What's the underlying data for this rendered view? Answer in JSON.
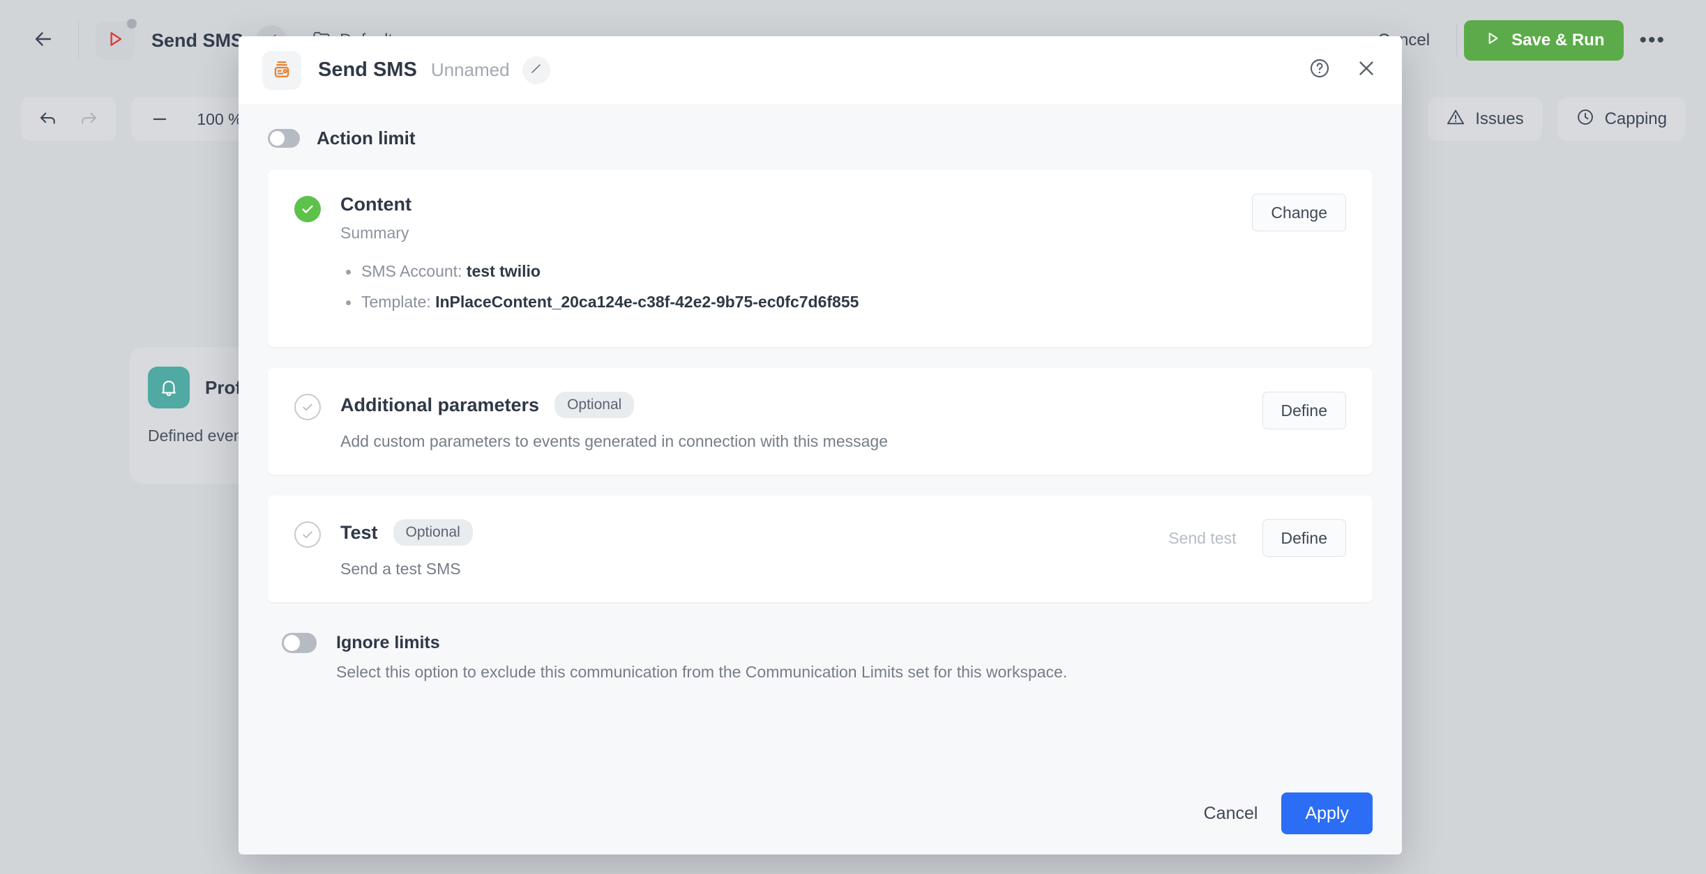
{
  "topbar": {
    "back_icon": "arrow-left-icon",
    "workflow_icon": "play-triangle-icon",
    "workflow_title": "Send SMS",
    "edit_icon": "pencil-icon",
    "folder_label": "Default",
    "folder_icon": "folder-icon",
    "chevron_icon": "chevron-down-icon",
    "cancel_label": "Cancel",
    "save_run_label": "Save & Run",
    "save_run_color": "#5cab4a",
    "overflow_label": "•••"
  },
  "toolbar": {
    "undo_icon": "undo-arrow-icon",
    "redo_icon": "redo-arrow-icon",
    "zoom_out_label": "−",
    "zoom_value": "100 %",
    "zoom_in_label": "+",
    "issues_label": "Issues",
    "issues_icon": "warning-triangle-icon",
    "capping_label": "Capping",
    "capping_icon": "clock-icon"
  },
  "canvas_node": {
    "icon": "bell-icon",
    "icon_color": "#50a9a3",
    "title": "Prof",
    "description": "Defined even workflow"
  },
  "modal": {
    "app_icon": "sms-card-icon",
    "app_icon_color": "#e8802e",
    "title": "Send SMS",
    "name_placeholder": "Unnamed",
    "edit_icon": "pencil-icon",
    "help_icon": "help-circle-icon",
    "close_icon": "close-icon",
    "action_limit": {
      "label": "Action limit",
      "enabled": false
    },
    "sections": [
      {
        "id": "content",
        "status": "done",
        "title": "Content",
        "badge": null,
        "subtitle": "Summary",
        "description": null,
        "bullets": [
          {
            "label": "SMS Account:",
            "value": "test twilio"
          },
          {
            "label": "Template:",
            "value": "InPlaceContent_20ca124e-c38f-42e2-9b75-ec0fc7d6f855"
          }
        ],
        "primary_action": "Change",
        "secondary_action": null
      },
      {
        "id": "additional-parameters",
        "status": "todo",
        "title": "Additional parameters",
        "badge": "Optional",
        "subtitle": null,
        "description": "Add custom parameters to events generated in connection with this message",
        "bullets": [],
        "primary_action": "Define",
        "secondary_action": null
      },
      {
        "id": "test",
        "status": "todo",
        "title": "Test",
        "badge": "Optional",
        "subtitle": null,
        "description": "Send a test SMS",
        "bullets": [],
        "primary_action": "Define",
        "secondary_action": "Send test"
      }
    ],
    "ignore_limits": {
      "label": "Ignore limits",
      "description": "Select this option to exclude this communication from the Communication Limits set for this workspace.",
      "enabled": false
    },
    "footer": {
      "cancel_label": "Cancel",
      "apply_label": "Apply",
      "apply_color": "#2b6ef5"
    }
  }
}
